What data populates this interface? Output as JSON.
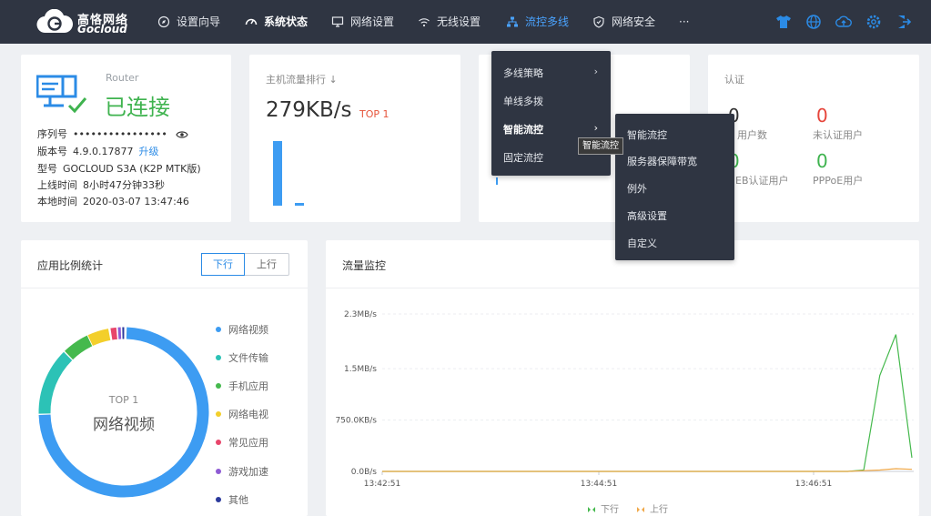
{
  "brand": {
    "name_cn": "高恪网络",
    "name_en": "Gocloud"
  },
  "nav": [
    {
      "label": "设置向导",
      "icon": "compass-icon"
    },
    {
      "label": "系统状态",
      "icon": "dashboard-icon"
    },
    {
      "label": "网络设置",
      "icon": "monitor-icon"
    },
    {
      "label": "无线设置",
      "icon": "wifi-icon"
    },
    {
      "label": "流控多线",
      "icon": "network-tree-icon"
    },
    {
      "label": "网络安全",
      "icon": "shield-icon"
    },
    {
      "label": "···",
      "icon": ""
    }
  ],
  "router": {
    "type_label": "Router",
    "status": "已连接",
    "serial_label": "序列号",
    "serial_value": "••••••••••••••••",
    "version_label": "版本号",
    "version_value": "4.9.0.17877",
    "upgrade_link": "升级",
    "model_label": "型号",
    "model_value": "GOCLOUD S3A (K2P MTK版)",
    "uptime_label": "上线时间",
    "uptime_value": "8小时47分钟33秒",
    "localtime_label": "本地时间",
    "localtime_value": "2020-03-07 13:47:46"
  },
  "host_traffic": {
    "title": "主机流量排行 ↓",
    "value": "279KB/s",
    "badge": "TOP 1"
  },
  "card3": {
    "partial_text": ""
  },
  "auth": {
    "title": "认证",
    "items": [
      {
        "value": "0",
        "label": "用户数"
      },
      {
        "value": "0",
        "label": "未认证用户"
      },
      {
        "value": "0",
        "label": "EB认证用户"
      },
      {
        "value": "0",
        "label": "PPPoE用户"
      }
    ]
  },
  "app_stats": {
    "title": "应用比例统计",
    "tab_down": "下行",
    "tab_up": "上行",
    "top_label": "TOP 1",
    "top_name": "网络视频",
    "legend": [
      {
        "name": "网络视频",
        "color": "#3d9cf2"
      },
      {
        "name": "文件传输",
        "color": "#2cc2b6"
      },
      {
        "name": "手机应用",
        "color": "#45b94d"
      },
      {
        "name": "网络电视",
        "color": "#f3cf2b"
      },
      {
        "name": "常见应用",
        "color": "#e8456b"
      },
      {
        "name": "游戏加速",
        "color": "#8e5bd4"
      },
      {
        "name": "其他",
        "color": "#2b3a9c"
      }
    ]
  },
  "traffic_monitor": {
    "title": "流量监控"
  },
  "chart_data": {
    "type": "line",
    "title": "流量监控",
    "y_ticks": [
      "2.3MB/s",
      "1.5MB/s",
      "750.0KB/s",
      "0.0B/s"
    ],
    "x_ticks": [
      "13:42:51",
      "13:44:51",
      "13:46:51"
    ],
    "series": [
      {
        "name": "下行",
        "color": "#45b94d",
        "values_note_mbps": [
          0,
          0,
          0,
          0,
          0,
          0,
          0,
          0,
          0,
          0,
          0,
          0,
          0,
          0,
          0,
          0,
          0,
          0,
          0,
          0,
          0,
          0,
          0,
          0,
          0,
          0,
          0,
          0,
          0,
          0,
          0.02,
          1.4,
          2.0,
          0.2
        ]
      },
      {
        "name": "上行",
        "color": "#f0a848",
        "values_note_mbps": [
          0,
          0,
          0,
          0,
          0,
          0,
          0,
          0,
          0,
          0,
          0,
          0,
          0,
          0,
          0,
          0,
          0,
          0,
          0,
          0,
          0,
          0,
          0,
          0,
          0,
          0,
          0,
          0,
          0,
          0,
          0.01,
          0.02,
          0.04,
          0.03
        ]
      }
    ],
    "ylim_mbps": [
      0,
      2.3
    ]
  },
  "menu_level1": [
    {
      "label": "多线策略",
      "arrow": "›"
    },
    {
      "label": "单线多拨",
      "arrow": ""
    },
    {
      "label": "智能流控",
      "arrow": "›"
    },
    {
      "label": "固定流控",
      "arrow": ""
    }
  ],
  "menu_level2": [
    {
      "label": "智能流控"
    },
    {
      "label": "服务器保障带宽"
    },
    {
      "label": "例外"
    },
    {
      "label": "高级设置"
    },
    {
      "label": "自定义"
    }
  ],
  "tooltip": "智能流控"
}
